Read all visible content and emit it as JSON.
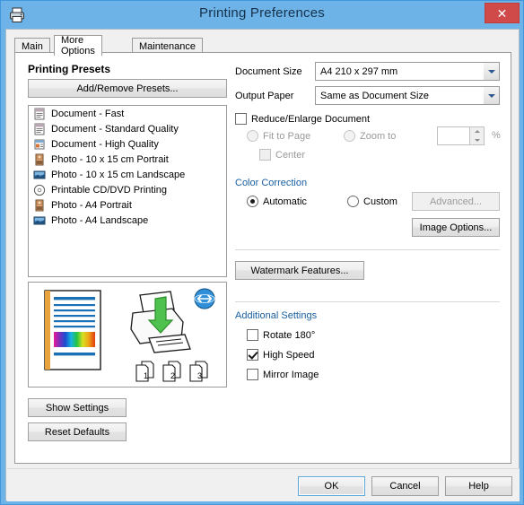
{
  "window": {
    "title": "Printing Preferences",
    "icon": "printer-icon",
    "close_label": "✕"
  },
  "tabs": [
    {
      "id": "main",
      "label": "Main",
      "active": false
    },
    {
      "id": "more-options",
      "label": "More Options",
      "active": true
    },
    {
      "id": "maintenance",
      "label": "Maintenance",
      "active": false
    }
  ],
  "presets": {
    "title": "Printing Presets",
    "add_remove_label": "Add/Remove Presets...",
    "items": [
      {
        "label": "Document - Fast",
        "icon": "document-icon"
      },
      {
        "label": "Document - Standard Quality",
        "icon": "document-icon"
      },
      {
        "label": "Document - High Quality",
        "icon": "document-hq-icon"
      },
      {
        "label": "Photo - 10 x 15 cm Portrait",
        "icon": "photo-portrait-icon"
      },
      {
        "label": "Photo - 10 x 15 cm Landscape",
        "icon": "photo-landscape-icon"
      },
      {
        "label": "Printable CD/DVD Printing",
        "icon": "cd-dvd-icon"
      },
      {
        "label": "Photo - A4 Portrait",
        "icon": "photo-portrait-icon"
      },
      {
        "label": "Photo - A4 Landscape",
        "icon": "photo-landscape-icon"
      }
    ]
  },
  "preview": {
    "page_numbers": [
      "1",
      "2",
      "3"
    ],
    "globe_badge": "bidirectional-icon"
  },
  "left_buttons": {
    "show_settings": "Show Settings",
    "reset_defaults": "Reset Defaults"
  },
  "paper": {
    "document_size_label": "Document Size",
    "document_size_value": "A4 210 x 297 mm",
    "output_paper_label": "Output Paper",
    "output_paper_value": "Same as Document Size",
    "reduce_enlarge_label": "Reduce/Enlarge Document",
    "reduce_enlarge_checked": false,
    "fit_to_page_label": "Fit to Page",
    "fit_to_page_selected": false,
    "zoom_to_label": "Zoom to",
    "zoom_to_selected": false,
    "zoom_value": "",
    "percent_label": "%",
    "center_label": "Center",
    "center_checked": false
  },
  "color_correction": {
    "title": "Color Correction",
    "automatic_label": "Automatic",
    "automatic_selected": true,
    "custom_label": "Custom",
    "custom_selected": false,
    "advanced_label": "Advanced...",
    "advanced_enabled": false,
    "image_options_label": "Image Options...",
    "watermark_label": "Watermark Features..."
  },
  "additional_settings": {
    "title": "Additional Settings",
    "options": [
      {
        "label": "Rotate 180°",
        "checked": false
      },
      {
        "label": "High Speed",
        "checked": true
      },
      {
        "label": "Mirror Image",
        "checked": false
      }
    ]
  },
  "footer": {
    "ok": "OK",
    "cancel": "Cancel",
    "help": "Help"
  },
  "colors": {
    "titlebar": "#6db3e8",
    "close": "#d04a4a",
    "accent": "#1a6fb5",
    "preview_spine": "#e8a33d",
    "preview_line": "#1a6fb5"
  }
}
